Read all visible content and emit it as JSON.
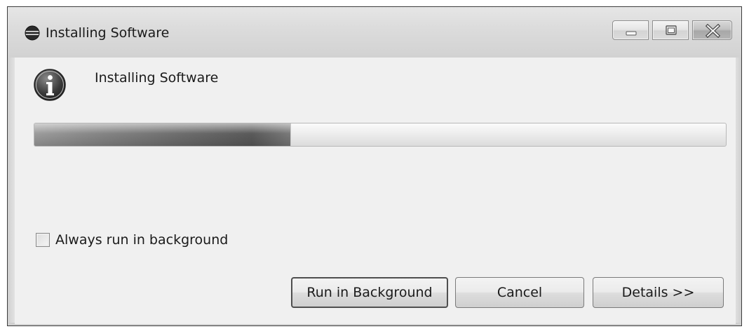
{
  "window": {
    "title": "Installing Software",
    "icon": "eclipse-app-icon",
    "controls": {
      "minimize_icon": "minimize-icon",
      "maximize_icon": "maximize-icon",
      "close_icon": "close-icon"
    }
  },
  "dialog": {
    "message": "Installing Software",
    "message_icon": "info-icon",
    "progress_fraction": 0.37,
    "always_background": {
      "label": "Always run in background",
      "checked": false
    },
    "buttons": {
      "run_in_background": "Run in Background",
      "cancel": "Cancel",
      "details": "Details >>"
    }
  },
  "colors": {
    "dialog_background": "#f0f0f0",
    "progress_fill": "#6f6f6f"
  }
}
